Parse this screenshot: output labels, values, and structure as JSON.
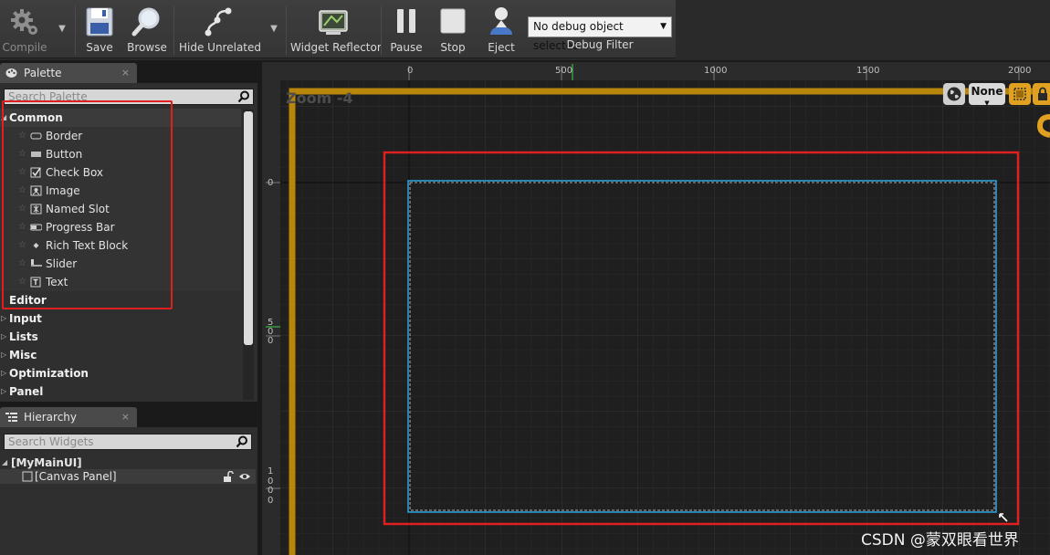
{
  "toolbar": {
    "buttons": [
      {
        "label": "Compile",
        "icon": "gear-icon"
      },
      {
        "label": "Save",
        "icon": "save-icon"
      },
      {
        "label": "Browse",
        "icon": "magnifier-icon"
      },
      {
        "label": "Hide Unrelated",
        "icon": "node-graph-icon"
      },
      {
        "label": "Widget Reflector",
        "icon": "widget-reflector-icon"
      },
      {
        "label": "Pause",
        "icon": "pause-icon"
      },
      {
        "label": "Stop",
        "icon": "stop-icon"
      },
      {
        "label": "Eject",
        "icon": "eject-icon"
      }
    ],
    "debug_select": "No debug object selected",
    "debug_label": "Debug Filter"
  },
  "palette": {
    "tab_title": "Palette",
    "close": "×",
    "search_placeholder": "Search Palette",
    "categories": {
      "common": "Common",
      "editor": "Editor",
      "input": "Input",
      "lists": "Lists",
      "misc": "Misc",
      "optimization": "Optimization",
      "panel": "Panel"
    },
    "common_items": [
      "Border",
      "Button",
      "Check Box",
      "Image",
      "Named Slot",
      "Progress Bar",
      "Rich Text Block",
      "Slider",
      "Text"
    ]
  },
  "hierarchy": {
    "tab_title": "Hierarchy",
    "close": "×",
    "search_placeholder": "Search Widgets",
    "root": "[MyMainUI]",
    "child": "[Canvas Panel]"
  },
  "designer": {
    "zoom": "Zoom -4",
    "ruler_top": [
      "0",
      "500",
      "1000",
      "1500",
      "2000"
    ],
    "ruler_left": [
      "0",
      "5\n0\n0",
      "1\n0\n0\n0"
    ],
    "screen_size_option": "None"
  },
  "colors": {
    "annotation": "#e02020",
    "canvas_border": "#2ea8e0",
    "safe_zone": "#b8860b",
    "accent": "#e0a020"
  },
  "watermark": "CSDN @蒙双眼看世界"
}
